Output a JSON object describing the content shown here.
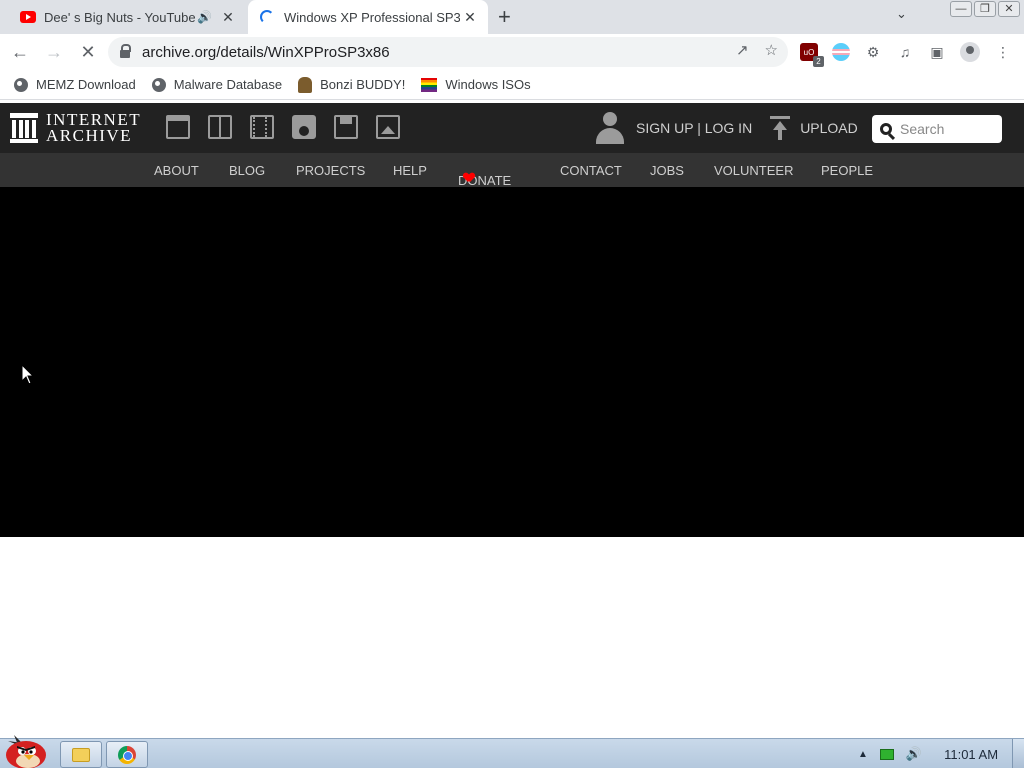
{
  "browser": {
    "tabs": [
      {
        "title": "Dee'  s Big Nuts - YouTube",
        "favicon": "youtube-icon",
        "audio": true
      },
      {
        "title": "Windows XP Professional SP3",
        "favicon": "loading-spinner-icon",
        "active": true
      }
    ],
    "new_tab_label": "+",
    "url": "archive.org/details/WinXPProSP3x86",
    "extensions": {
      "ublock_badge": "2"
    }
  },
  "bookmarks": [
    {
      "label": "MEMZ Download",
      "icon": "globe-icon"
    },
    {
      "label": "Malware Database",
      "icon": "globe-icon"
    },
    {
      "label": "Bonzi BUDDY!",
      "icon": "bonzi-icon"
    },
    {
      "label": "Windows ISOs",
      "icon": "rainbow-flag-icon"
    }
  ],
  "ia": {
    "logo_line1": "INTERNET",
    "logo_line2": "ARCHIVE",
    "signup": "SIGN UP | LOG IN",
    "upload": "UPLOAD",
    "search_placeholder": "Search",
    "nav": [
      "ABOUT",
      "BLOG",
      "PROJECTS",
      "HELP",
      "DONATE",
      "CONTACT",
      "JOBS",
      "VOLUNTEER",
      "PEOPLE"
    ]
  },
  "taskbar": {
    "clock": "11:01 AM"
  },
  "colors": {
    "ia_header": "#222222",
    "ia_nav": "#333333",
    "player_bg": "#000000",
    "donate_heart": "#ff0000"
  }
}
